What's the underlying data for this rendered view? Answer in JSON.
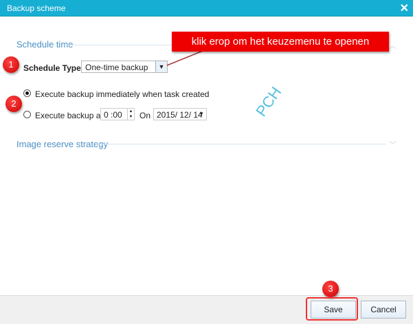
{
  "window": {
    "title": "Backup scheme",
    "close_icon": "close-icon"
  },
  "schedule": {
    "section_title": "Schedule time",
    "type_label": "Schedule Type:",
    "type_value": "One-time backup",
    "option_immediate": "Execute backup immediately when task created",
    "option_at": "Execute backup at",
    "time_value": "0 :00",
    "on_label": "On",
    "date_value": "2015/ 12/ 14"
  },
  "reserve": {
    "section_title": "Image reserve strategy"
  },
  "annotations": {
    "callout": "klik erop om het keuzemenu te openen",
    "badge1": "1",
    "badge2": "2",
    "badge3": "3",
    "watermark": "PCH"
  },
  "footer": {
    "save": "Save",
    "cancel": "Cancel"
  }
}
